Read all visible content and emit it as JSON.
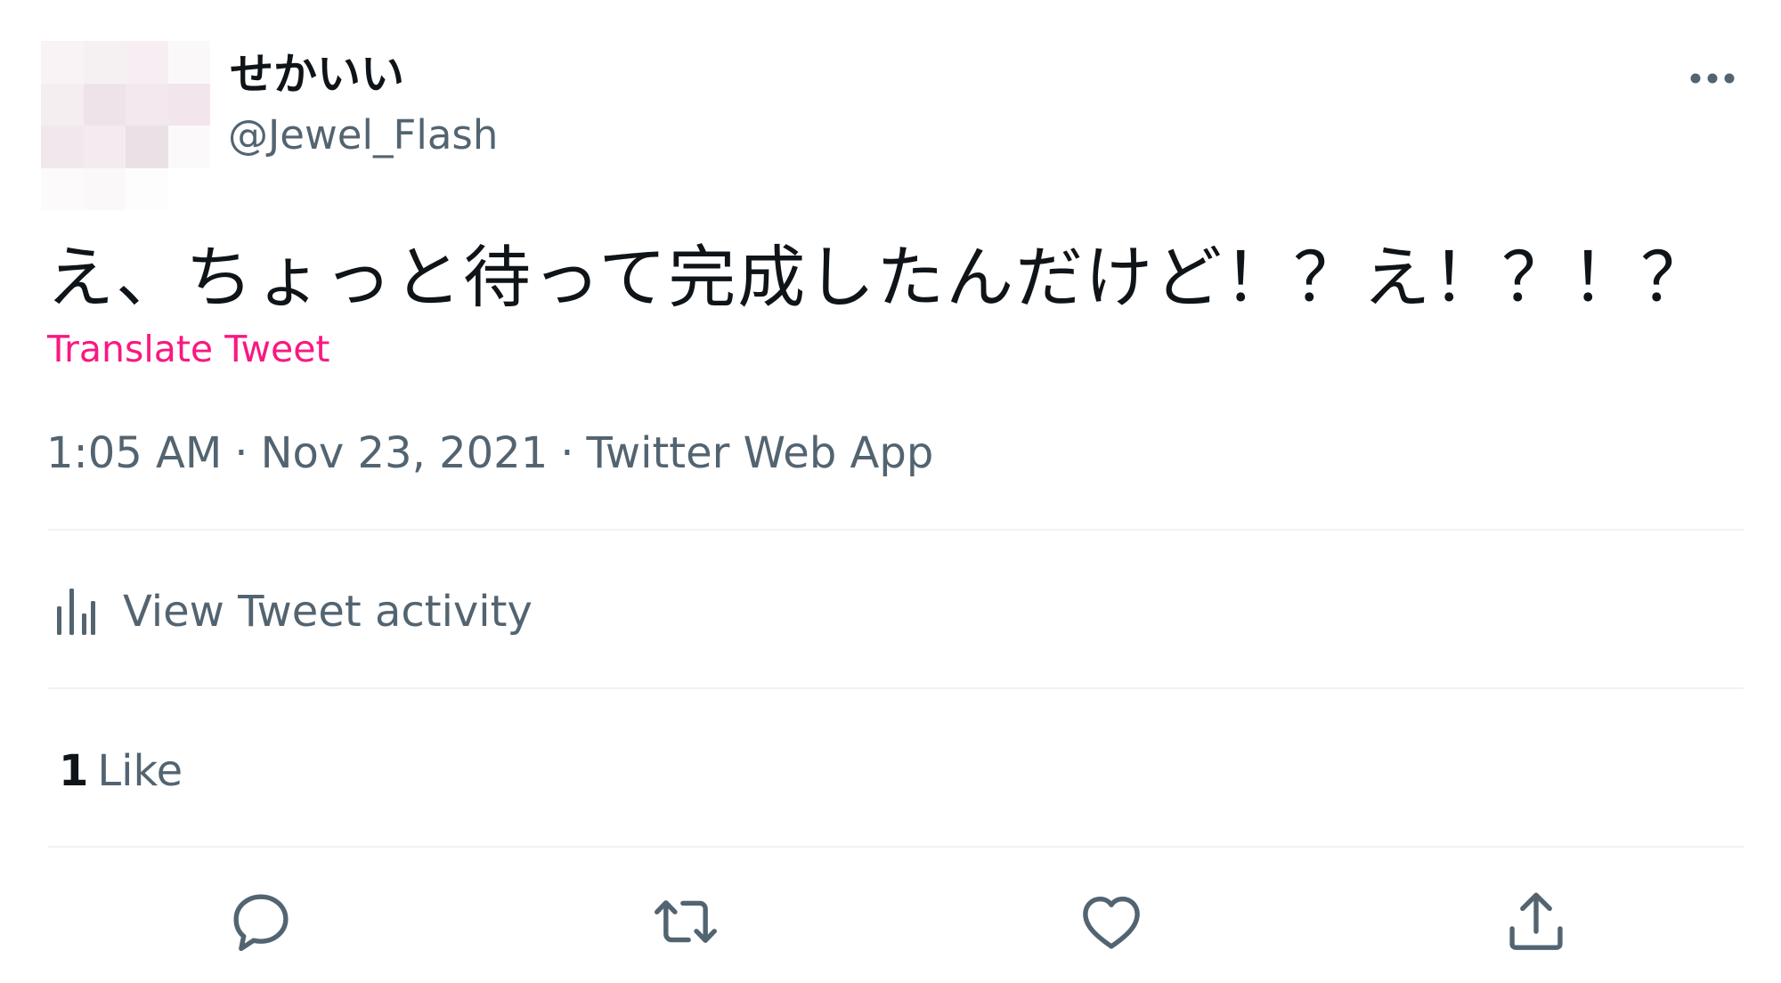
{
  "tweet": {
    "display_name": "せかいい",
    "handle": "@Jewel_Flash",
    "more_icon": "more-horizontal-icon",
    "text": "え、ちょっと待って完成したんだけど！？え！？！？",
    "translate_label": "Translate Tweet",
    "time": "1:05 AM",
    "date": "Nov 23, 2021",
    "source": "Twitter Web App",
    "separator": "·",
    "activity_label": "View Tweet activity",
    "activity_icon": "bar-chart-icon",
    "like_count": "1",
    "like_label": "Like",
    "actions": [
      {
        "icon": "reply-icon"
      },
      {
        "icon": "retweet-icon"
      },
      {
        "icon": "heart-icon"
      },
      {
        "icon": "share-icon"
      }
    ]
  },
  "colors": {
    "primary_text": "#0f1419",
    "secondary_text": "#536471",
    "accent": "#f91880",
    "divider": "#eff3f4"
  }
}
